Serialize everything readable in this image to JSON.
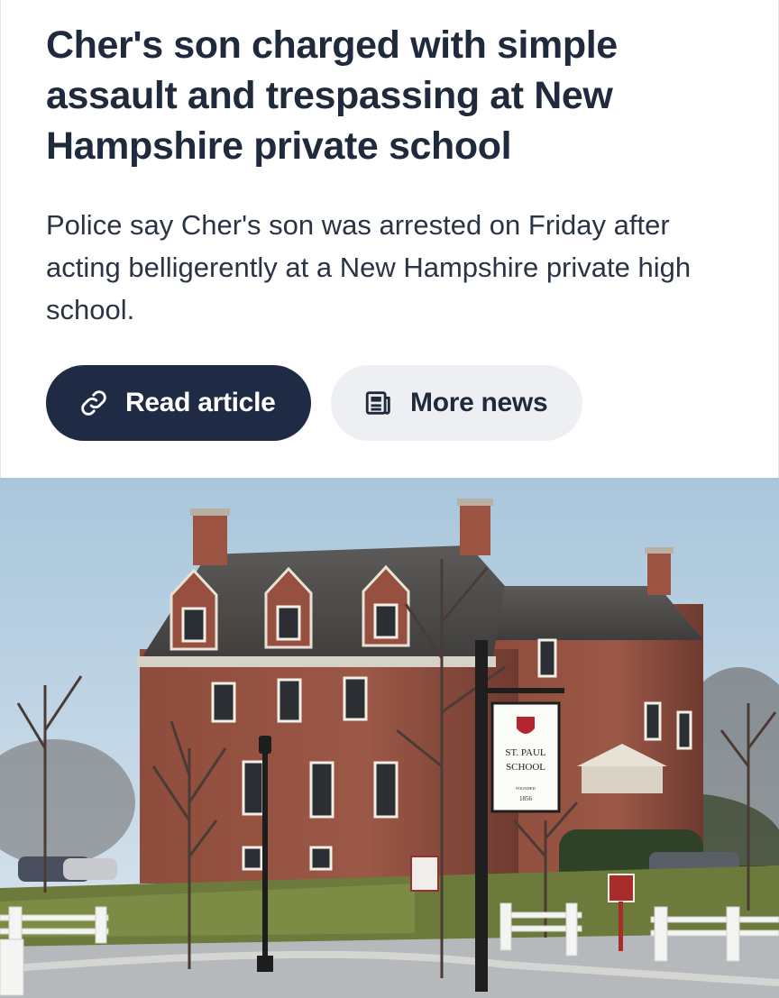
{
  "article": {
    "headline": "Cher's son charged with simple assault and trespassing at New Hampshire private school",
    "summary": "Police say Cher's son was arrested on Friday after acting belligerently at a New Hampshire private high school."
  },
  "actions": {
    "read_article": {
      "label": "Read article",
      "icon": "link-icon"
    },
    "more_news": {
      "label": "More news",
      "icon": "newspaper-icon"
    }
  },
  "photo": {
    "sign_line1": "ST. PAUL",
    "sign_line2": "SCHOOL",
    "sign_founded": "FOUNDED",
    "sign_year": "1856"
  },
  "colors": {
    "text_dark": "#1f2a3d",
    "primary_button": "#1f2b44",
    "secondary_button": "#eeeff2"
  }
}
